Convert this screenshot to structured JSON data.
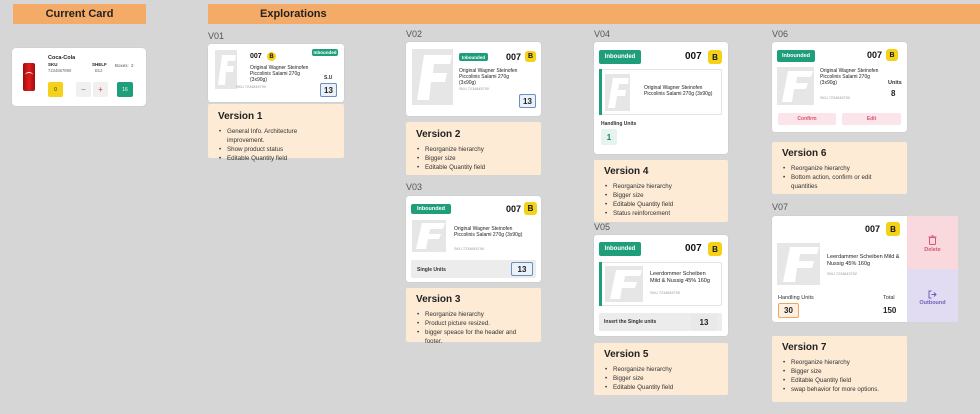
{
  "headers": {
    "current": "Current Card",
    "explorations": "Explorations"
  },
  "current_card": {
    "name": "Coca-Cola",
    "sku_label": "SKU",
    "sku_value": "7234567890",
    "shelf_label": "SHELF",
    "shelf_value": "B12",
    "boxes_label": "Boxes:",
    "boxes_value": "2",
    "left_value": "0",
    "minus": "−",
    "plus": "+",
    "right_value": "16"
  },
  "versions": {
    "v01": {
      "label": "V01",
      "code": "007",
      "badge": "B",
      "status": "Inbounded",
      "product": "Original Wagner Steinofen Piccolinis Salami 270g (3x90g)",
      "sku": "SKU 7234845790",
      "unit_label": "S.U",
      "qty": "13",
      "title": "Version 1",
      "bullets": [
        "General Info. Architecture improvement.",
        "Show product status",
        "Editable Quantity field"
      ]
    },
    "v02": {
      "label": "V02",
      "code": "007",
      "badge": "B",
      "status": "Inbounded",
      "product": "Original Wagner Steinofen Piccolinis Salami 270g (3x90g)",
      "sku": "SKU 7234845790",
      "qty": "13",
      "title": "Version 2",
      "bullets": [
        "Reorganize hierarchy",
        "Bigger size",
        "Editable Quantity field"
      ]
    },
    "v03": {
      "label": "V03",
      "code": "007",
      "badge": "B",
      "status": "Inbounded",
      "product": "Original Wagner Steinofen Piccolinis Salami 270g (3x90g)",
      "sku": "SKU 7234845790",
      "unit_label": "Single Units",
      "qty": "13",
      "title": "Version 3",
      "bullets": [
        "Reorganize hierarchy",
        "Product picture resized.",
        "bigger speace for the header and footer."
      ]
    },
    "v04": {
      "label": "V04",
      "code": "007",
      "badge": "B",
      "status": "Inbounded",
      "product": "Original Wagner Steinofen Piccolinis Salami 270g (3x90g)",
      "unit_label": "Handling Units",
      "qty": "1",
      "title": "Version 4",
      "bullets": [
        "Reorganize hierarchy",
        "Bigger size",
        "Editable Quantity field",
        "Status reinforcement"
      ]
    },
    "v05": {
      "label": "V05",
      "code": "007",
      "badge": "B",
      "status": "Inbounded",
      "product": "Leerdommer Scheiben Mild & Nussig 45% 160g",
      "sku": "SKU 7234845790",
      "unit_label": "Insert the Single units",
      "qty": "13",
      "title": "Version 5",
      "bullets": [
        "Reorganize hierarchy",
        "Bigger size",
        "Editable Quantity field"
      ]
    },
    "v06": {
      "label": "V06",
      "code": "007",
      "badge": "B",
      "status": "Inbounded",
      "product": "Original Wagner Steinofen Piccolinis Salami 270g (3x90g)",
      "sku": "SKU 7234845790",
      "unit_label": "Units",
      "qty": "8",
      "confirm": "Confirm",
      "edit": "Edit",
      "title": "Version 6",
      "bullets": [
        "Reorganize hierarchy",
        "Bottom action, confirm or edit quantities"
      ]
    },
    "v07": {
      "label": "V07",
      "code": "007",
      "badge": "B",
      "product": "Leerdammer Scheiben Mild & Nussig 45% 160g",
      "sku": "SKU 7234843792",
      "unit_label": "Handling Units",
      "qty": "30",
      "total_label": "Total",
      "total_value": "150",
      "delete": "Delete",
      "outbound": "Outbound",
      "title": "Version 7",
      "bullets": [
        "Reorganize hierarchy",
        "Bigger size",
        "Editable Quantity field",
        "swap behavior for more options."
      ]
    }
  },
  "colors": {
    "inbound": "#1e9e7a",
    "badge": "#f5d21a",
    "header": "#f5ab68",
    "note": "#fdebd6"
  }
}
